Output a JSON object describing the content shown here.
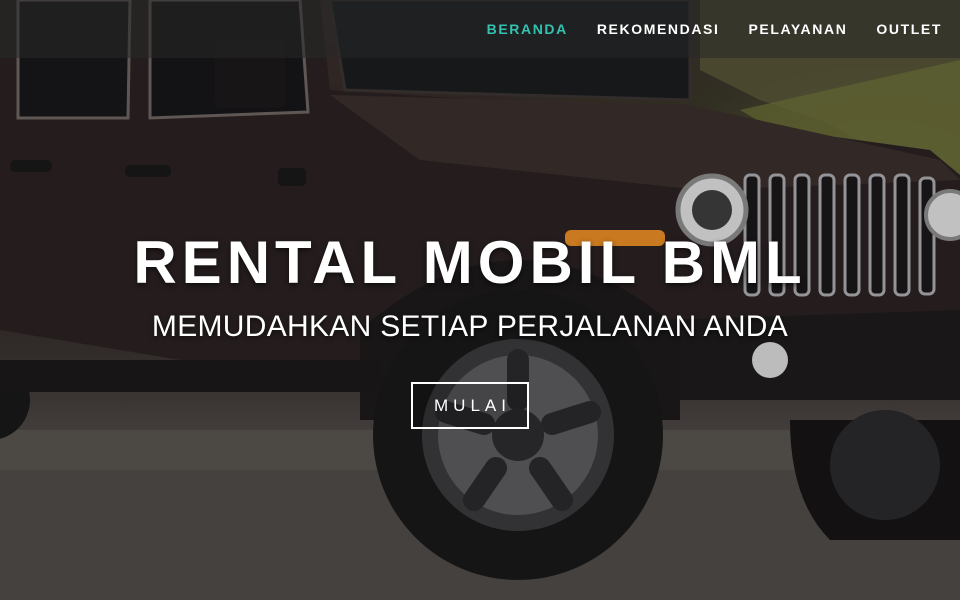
{
  "hero": {
    "title": "RENTAL MOBIL BML",
    "subtitle": "MEMUDAHKAN SETIAP PERJALANAN ANDA",
    "cta_label": "MULAI"
  },
  "nav": {
    "items": [
      {
        "label": "BERANDA",
        "active": true
      },
      {
        "label": "REKOMENDASI",
        "active": false
      },
      {
        "label": "PELAYANAN",
        "active": false
      },
      {
        "label": "OUTLET",
        "active": false
      }
    ]
  },
  "colors": {
    "accent": "#33c2b0",
    "nav_bg": "rgba(40,40,40,0.55)",
    "text": "#ffffff"
  }
}
